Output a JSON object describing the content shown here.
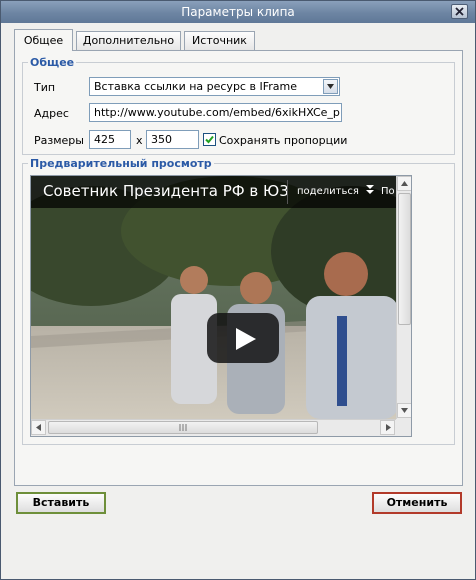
{
  "dialog": {
    "title": "Параметры клипа"
  },
  "tabs": [
    {
      "label": "Общее",
      "active": true
    },
    {
      "label": "Дополнительно",
      "active": false
    },
    {
      "label": "Источник",
      "active": false
    }
  ],
  "general_group": {
    "legend": "Общее",
    "type_label": "Тип",
    "type_value": "Вставка ссылки на ресурс в IFrame",
    "address_label": "Адрес",
    "address_value": "http://www.youtube.com/embed/6xikHXCe_p",
    "size_label": "Размеры",
    "width": "425",
    "times": "x",
    "height": "350",
    "keep_ratio_label": "Сохранять пропорции",
    "keep_ratio_checked": true
  },
  "preview_group": {
    "legend": "Предварительный просмотр",
    "video_title": "Советник Президента РФ в  Ю3",
    "share_label": "поделиться",
    "more_label": "По"
  },
  "buttons": {
    "insert": "Вставить",
    "cancel": "Отменить"
  },
  "colors": {
    "accent_blue": "#2b5aa6",
    "insert_border": "#6e8f3a",
    "cancel_border": "#b23a2a",
    "titlebar": "#6d85a3"
  }
}
